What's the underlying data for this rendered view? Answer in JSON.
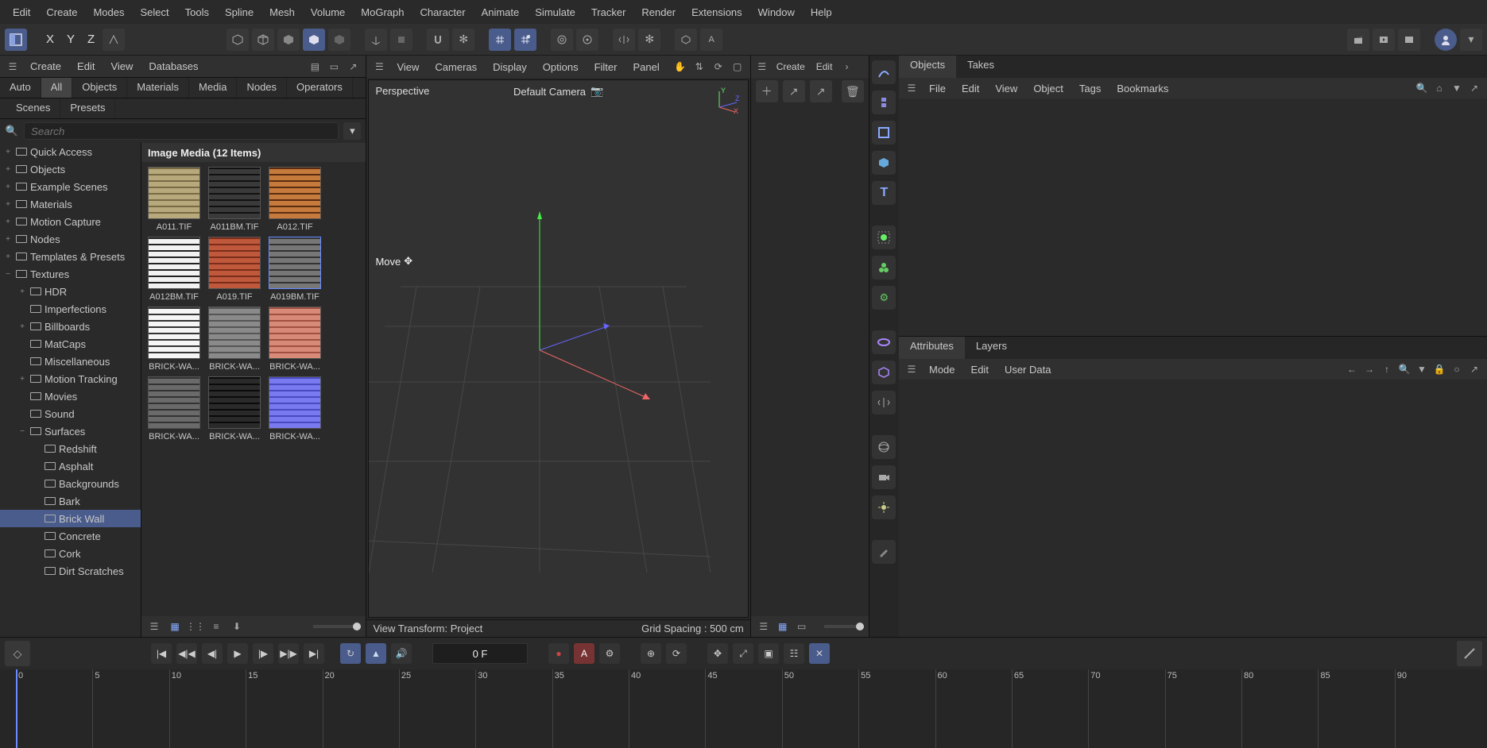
{
  "menu": [
    "Edit",
    "Create",
    "Modes",
    "Select",
    "Tools",
    "Spline",
    "Mesh",
    "Volume",
    "MoGraph",
    "Character",
    "Animate",
    "Simulate",
    "Tracker",
    "Render",
    "Extensions",
    "Window",
    "Help"
  ],
  "axes": [
    "X",
    "Y",
    "Z"
  ],
  "leftPanel": {
    "bar": [
      "Create",
      "Edit",
      "View",
      "Databases"
    ],
    "tabs": [
      "Auto",
      "All",
      "Objects",
      "Materials",
      "Media",
      "Nodes",
      "Operators"
    ],
    "activeTab": "All",
    "subtabs": [
      "Scenes",
      "Presets"
    ],
    "searchPlaceholder": "Search",
    "gridTitle": "Image Media (12 Items)",
    "tree": [
      {
        "label": "Quick Access",
        "lvl": 0,
        "exp": "+"
      },
      {
        "label": "Objects",
        "lvl": 0,
        "exp": "+"
      },
      {
        "label": "Example Scenes",
        "lvl": 0,
        "exp": "+"
      },
      {
        "label": "Materials",
        "lvl": 0,
        "exp": "+"
      },
      {
        "label": "Motion Capture",
        "lvl": 0,
        "exp": "+"
      },
      {
        "label": "Nodes",
        "lvl": 0,
        "exp": "+"
      },
      {
        "label": "Templates & Presets",
        "lvl": 0,
        "exp": "+"
      },
      {
        "label": "Textures",
        "lvl": 0,
        "exp": "−"
      },
      {
        "label": "HDR",
        "lvl": 1,
        "exp": "+"
      },
      {
        "label": "Imperfections",
        "lvl": 1,
        "exp": ""
      },
      {
        "label": "Billboards",
        "lvl": 1,
        "exp": "+"
      },
      {
        "label": "MatCaps",
        "lvl": 1,
        "exp": ""
      },
      {
        "label": "Miscellaneous",
        "lvl": 1,
        "exp": ""
      },
      {
        "label": "Motion Tracking",
        "lvl": 1,
        "exp": "+"
      },
      {
        "label": "Movies",
        "lvl": 1,
        "exp": ""
      },
      {
        "label": "Sound",
        "lvl": 1,
        "exp": ""
      },
      {
        "label": "Surfaces",
        "lvl": 1,
        "exp": "−"
      },
      {
        "label": "Redshift",
        "lvl": 2,
        "exp": ""
      },
      {
        "label": "Asphalt",
        "lvl": 2,
        "exp": ""
      },
      {
        "label": "Backgrounds",
        "lvl": 2,
        "exp": ""
      },
      {
        "label": "Bark",
        "lvl": 2,
        "exp": ""
      },
      {
        "label": "Brick Wall",
        "lvl": 2,
        "exp": "",
        "sel": true
      },
      {
        "label": "Concrete",
        "lvl": 2,
        "exp": ""
      },
      {
        "label": "Cork",
        "lvl": 2,
        "exp": ""
      },
      {
        "label": "Dirt Scratches",
        "lvl": 2,
        "exp": ""
      }
    ],
    "thumbs": [
      {
        "name": "A011.TIF",
        "c1": "#b8a97c",
        "c2": "#776a44"
      },
      {
        "name": "A011BM.TIF",
        "c1": "#3a3a3a",
        "c2": "#111"
      },
      {
        "name": "A012.TIF",
        "c1": "#c67a3b",
        "c2": "#5a2d12"
      },
      {
        "name": "A012BM.TIF",
        "c1": "#f2f2f2",
        "c2": "#222"
      },
      {
        "name": "A019.TIF",
        "c1": "#c0583c",
        "c2": "#7a2d1a"
      },
      {
        "name": "A019BM.TIF",
        "c1": "#777",
        "c2": "#333",
        "sel": true
      },
      {
        "name": "BRICK-WA...",
        "c1": "#f5f5f5",
        "c2": "#333"
      },
      {
        "name": "BRICK-WA...",
        "c1": "#8a8a8a",
        "c2": "#555"
      },
      {
        "name": "BRICK-WA...",
        "c1": "#d88a78",
        "c2": "#a05040"
      },
      {
        "name": "BRICK-WA...",
        "c1": "#6a6a6a",
        "c2": "#333"
      },
      {
        "name": "BRICK-WA...",
        "c1": "#2a2a2a",
        "c2": "#0a0a0a"
      },
      {
        "name": "BRICK-WA...",
        "c1": "#7a7af0",
        "c2": "#4a4ac0"
      }
    ]
  },
  "viewport": {
    "bar": [
      "View",
      "Cameras",
      "Display",
      "Options",
      "Filter",
      "Panel"
    ],
    "tl": "Perspective",
    "tc": "Default Camera",
    "tool": "Move",
    "footL": "View Transform: Project",
    "footR": "Grid Spacing : 500 cm"
  },
  "om": {
    "bar": [
      "Create",
      "Edit"
    ]
  },
  "rightTop": {
    "tabs": [
      "Objects",
      "Takes"
    ],
    "bar": [
      "File",
      "Edit",
      "View",
      "Object",
      "Tags",
      "Bookmarks"
    ]
  },
  "rightBottom": {
    "tabs": [
      "Attributes",
      "Layers"
    ],
    "bar": [
      "Mode",
      "Edit",
      "User Data"
    ]
  },
  "timeline": {
    "frame": "0 F",
    "marks": [
      "0",
      "5",
      "10",
      "15",
      "20",
      "25",
      "30",
      "35",
      "40",
      "45",
      "50",
      "55",
      "60",
      "65",
      "70",
      "75",
      "80",
      "85",
      "90"
    ]
  }
}
